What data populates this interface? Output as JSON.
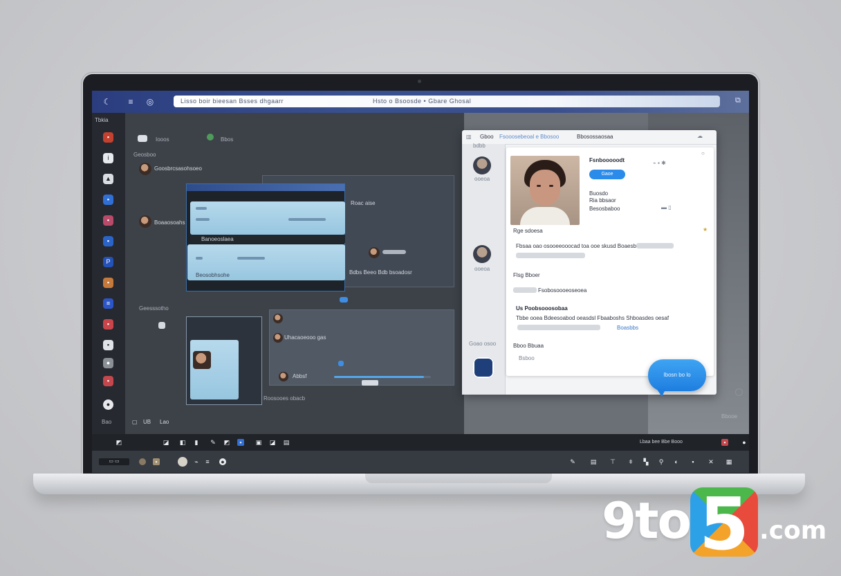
{
  "topbar": {
    "address_left": "Lisso boir bieesan Bsses dhgaarr",
    "address_right": "Hsto o Bsoosde • Gbare Ghosal",
    "icons": [
      "moon-icon",
      "menu-icon",
      "globe-icon",
      "share-icon"
    ]
  },
  "rail": {
    "top_label": "Tbkia",
    "items": [
      "app-red",
      "app-blue",
      "app-white",
      "app-blue",
      "app-pink",
      "app-blue",
      "app-blue",
      "app-orange",
      "app-blue",
      "app-red",
      "app-white",
      "app-gray",
      "app-red",
      "app-white"
    ],
    "bottom_label": "Bao"
  },
  "workspace": {
    "header_left": "Iooos",
    "header_mid": "Bbos",
    "section_label": "Geosboo",
    "contact1": "Goosbrcsasohsoeo",
    "contact2": "Boaaosoahs",
    "right_label1": "Roac aise",
    "right_label2": "Bdbs Beeo Bdb bsoadosr",
    "section2": "Geesssotho",
    "item2": "Uhacaoeooo gas",
    "item3": "Abbsf",
    "item4": "Roosooes obacb",
    "card_title": "Banoeoslaea",
    "card_sub": "Beosobhsohe",
    "bottom_label": "Bbosdhesbe",
    "bottom_small": "UB",
    "bottom_small2": "Lao"
  },
  "profile": {
    "tab1": "Gboo",
    "tab2": "Fsooosebeoal e Bbosoo",
    "tab3": "Bbosossaosaa",
    "side_label1": "bdbb",
    "side_label2": "ooeoa",
    "side_label3": "Goao osoo",
    "name": "Fsnbooooodt",
    "button": "Gaoe",
    "detail1": "Buosdo",
    "detail2": "Ria bbsaor",
    "detail3": "Besosbaboo",
    "row1": "Rge sdoesa",
    "row2": "Fbsaa oao osooeeooocad toa ooe skusd Boaesboe",
    "row3": "Flsg Bboer",
    "row4": "Fsobosoooeoseoea",
    "row5": "Us Poobsooosobaa",
    "row6": "Tbbe ooea Bdeesoabod oeasdsl Fbaaboshs Shboasdes oesaf",
    "row7": "Boasbbs",
    "row8": "Bboo Bbuaa",
    "row9": "Bsboo"
  },
  "chat_bubble": "Ibosn bo lo",
  "dock": {
    "left_text": "Bbooe",
    "right_text": "Lbaa bee Bbe Booo",
    "time": "12:00"
  },
  "watermark": {
    "left": "9to",
    "digit": "5",
    "right": ".com",
    "colors": [
      "#e84b3c",
      "#f3a329",
      "#2da1e8",
      "#4cb84b"
    ]
  }
}
